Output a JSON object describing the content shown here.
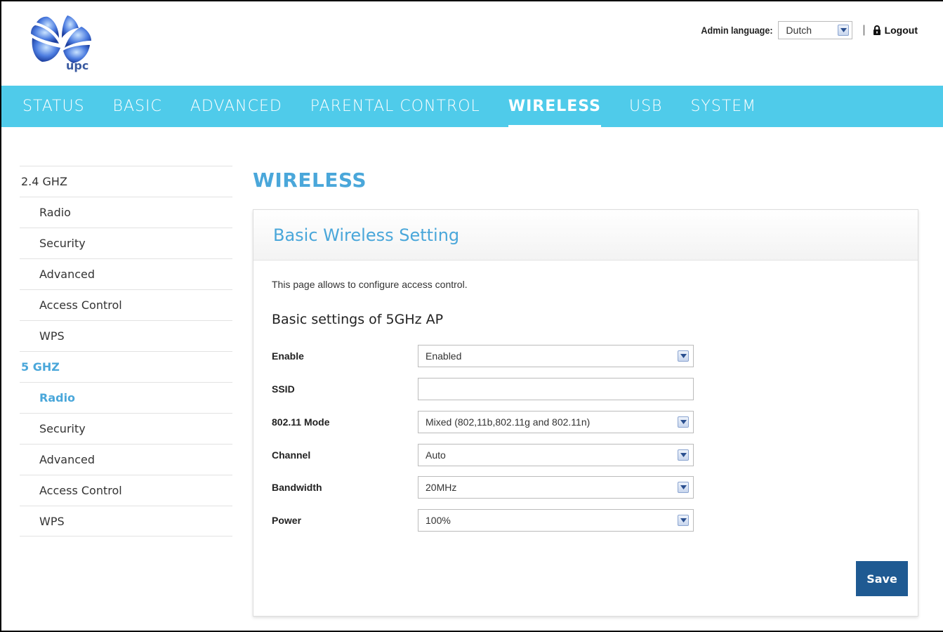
{
  "header": {
    "logo_text": "upc",
    "admin_language_label": "Admin language:",
    "admin_language_value": "Dutch",
    "separator": "|",
    "logout_label": "Logout"
  },
  "nav": {
    "items": [
      {
        "label": "STATUS"
      },
      {
        "label": "BASIC"
      },
      {
        "label": "ADVANCED"
      },
      {
        "label": "PARENTAL CONTROL"
      },
      {
        "label": "WIRELESS",
        "active": true
      },
      {
        "label": "USB"
      },
      {
        "label": "SYSTEM"
      }
    ]
  },
  "sidebar": {
    "items": [
      {
        "label": "2.4 GHZ"
      },
      {
        "label": "Radio"
      },
      {
        "label": "Security"
      },
      {
        "label": "Advanced"
      },
      {
        "label": "Access Control"
      },
      {
        "label": "WPS"
      },
      {
        "label": "5 GHZ"
      },
      {
        "label": "Radio"
      },
      {
        "label": "Security"
      },
      {
        "label": "Advanced"
      },
      {
        "label": "Access Control"
      },
      {
        "label": "WPS"
      }
    ]
  },
  "main": {
    "page_title": "WIRELESS",
    "panel_title": "Basic Wireless Setting",
    "intro": "This page allows to configure access control.",
    "subheading": "Basic settings of 5GHz AP",
    "fields": {
      "enable": {
        "label": "Enable",
        "value": "Enabled"
      },
      "ssid": {
        "label": "SSID",
        "value": ""
      },
      "mode": {
        "label": "802.11 Mode",
        "value": "Mixed (802,11b,802.11g and 802.11n)"
      },
      "channel": {
        "label": "Channel",
        "value": "Auto"
      },
      "bandwidth": {
        "label": "Bandwidth",
        "value": "20MHz"
      },
      "power": {
        "label": "Power",
        "value": "100%"
      }
    },
    "save_label": "Save"
  },
  "colors": {
    "nav_bg": "#4fcbea",
    "accent": "#4aa7da",
    "save_bg": "#1f5a92"
  }
}
